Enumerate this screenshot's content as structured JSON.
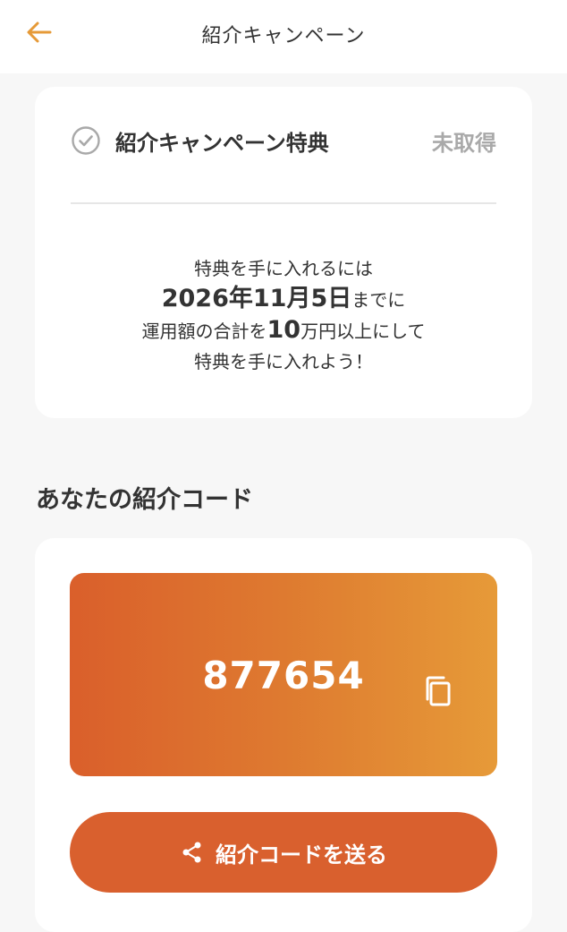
{
  "header": {
    "title": "紹介キャンペーン",
    "back_icon": "arrow-left-icon",
    "accent_color": "#e69a38"
  },
  "benefit": {
    "icon": "check-circle-icon",
    "title": "紹介キャンペーン特典",
    "status": "未取得",
    "message": {
      "line1": "特典を手に入れるには",
      "deadline": "2026年11月5日",
      "deadline_suffix": "までに",
      "line3_prefix": "運用額の合計を",
      "line3_amount": "10",
      "line3_suffix": "万円以上にして",
      "line4": "特典を手に入れよう！"
    }
  },
  "referral": {
    "section_title": "あなたの紹介コード",
    "code": "877654",
    "copy_icon": "copy-icon",
    "send_label": "紹介コードを送る",
    "send_icon": "share-icon",
    "gradient_colors": [
      "#da5f2b",
      "#e69a38"
    ],
    "button_color": "#d9602e"
  }
}
